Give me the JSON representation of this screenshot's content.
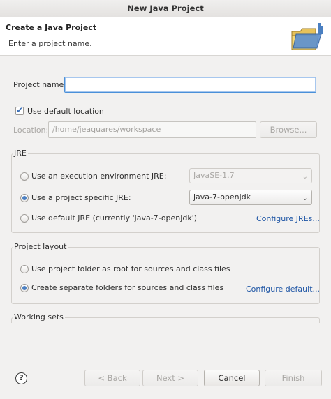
{
  "window": {
    "title": "New Java Project"
  },
  "header": {
    "title": "Create a Java Project",
    "message": "Enter a project name."
  },
  "project_name": {
    "label": "Project name:",
    "value": ""
  },
  "location": {
    "use_default_label": "Use default location",
    "use_default_checked": true,
    "label": "Location:",
    "value": "/home/jeaquares/workspace",
    "browse_label": "Browse..."
  },
  "jre": {
    "title": "JRE",
    "options": [
      {
        "label": "Use an execution environment JRE:",
        "selected": false
      },
      {
        "label": "Use a project specific JRE:",
        "selected": true
      },
      {
        "label": "Use default JRE (currently 'java-7-openjdk')",
        "selected": false
      }
    ],
    "env_combo_value": "JavaSE-1.7",
    "specific_combo_value": "java-7-openjdk",
    "configure_link": "Configure JREs..."
  },
  "layout": {
    "title": "Project layout",
    "options": [
      {
        "label": "Use project folder as root for sources and class files",
        "selected": false
      },
      {
        "label": "Create separate folders for sources and class files",
        "selected": true
      }
    ],
    "configure_link": "Configure default..."
  },
  "working_sets": {
    "title": "Working sets"
  },
  "buttons": {
    "back": "< Back",
    "next": "Next >",
    "cancel": "Cancel",
    "finish": "Finish"
  },
  "icons": {
    "help": "help-icon",
    "wizard": "new-java-project-folder-icon"
  }
}
